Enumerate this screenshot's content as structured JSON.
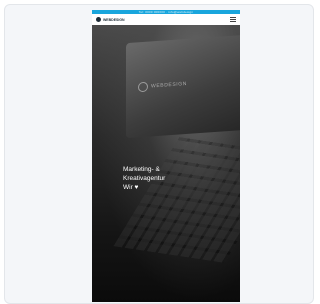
{
  "topbar": {
    "text": "Tel: 0000 000000 · info@webdesign"
  },
  "navbar": {
    "logo_text": "WEBDESIGN"
  },
  "screen": {
    "logo_text": "WEBDESIGN"
  },
  "hero": {
    "line1": "Marketing- &",
    "line2": "Kreativagentur",
    "line3": "Wir ♥"
  },
  "colors": {
    "topbar": "#19a6dd",
    "card_bg": "#f4f6f9",
    "hero_text": "#ffffff"
  }
}
